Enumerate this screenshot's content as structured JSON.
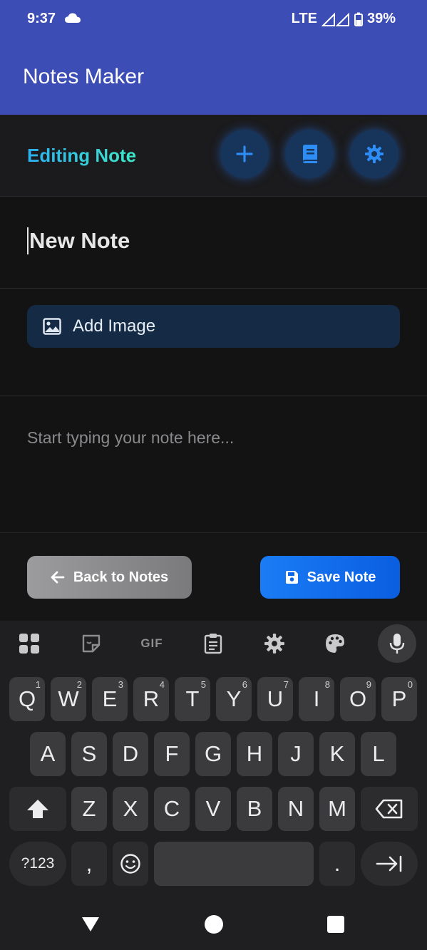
{
  "status_bar": {
    "time": "9:37",
    "network": "LTE",
    "battery": "39%",
    "icons": [
      "cloud-icon",
      "signal-icon",
      "battery-icon"
    ]
  },
  "app_bar": {
    "title": "Notes Maker"
  },
  "editor": {
    "heading": "Editing Note",
    "actions": [
      {
        "name": "new-note",
        "icon": "plus-icon"
      },
      {
        "name": "notebook",
        "icon": "book-icon"
      },
      {
        "name": "settings",
        "icon": "gear-icon"
      }
    ],
    "title_value": "New Note",
    "add_image_label": "Add Image",
    "body_placeholder": "Start typing your note here...",
    "back_label": "Back to Notes",
    "save_label": "Save Note"
  },
  "keyboard": {
    "toolbar": [
      "apps-icon",
      "sticker-icon",
      "GIF",
      "clipboard-icon",
      "gear-icon",
      "palette-icon",
      "mic-icon"
    ],
    "row1": [
      {
        "k": "Q",
        "h": "1"
      },
      {
        "k": "W",
        "h": "2"
      },
      {
        "k": "E",
        "h": "3"
      },
      {
        "k": "R",
        "h": "4"
      },
      {
        "k": "T",
        "h": "5"
      },
      {
        "k": "Y",
        "h": "6"
      },
      {
        "k": "U",
        "h": "7"
      },
      {
        "k": "I",
        "h": "8"
      },
      {
        "k": "O",
        "h": "9"
      },
      {
        "k": "P",
        "h": "0"
      }
    ],
    "row2": [
      "A",
      "S",
      "D",
      "F",
      "G",
      "H",
      "J",
      "K",
      "L"
    ],
    "row3": [
      "Z",
      "X",
      "C",
      "V",
      "B",
      "N",
      "M"
    ],
    "symbols_key": "?123",
    "comma_key": ",",
    "period_key": "."
  },
  "colors": {
    "app_bar": "#3c4db6",
    "accent_blue": "#1a7cf6",
    "editing_gradient_start": "#2bb0f0",
    "editing_gradient_end": "#3ee7c8"
  }
}
